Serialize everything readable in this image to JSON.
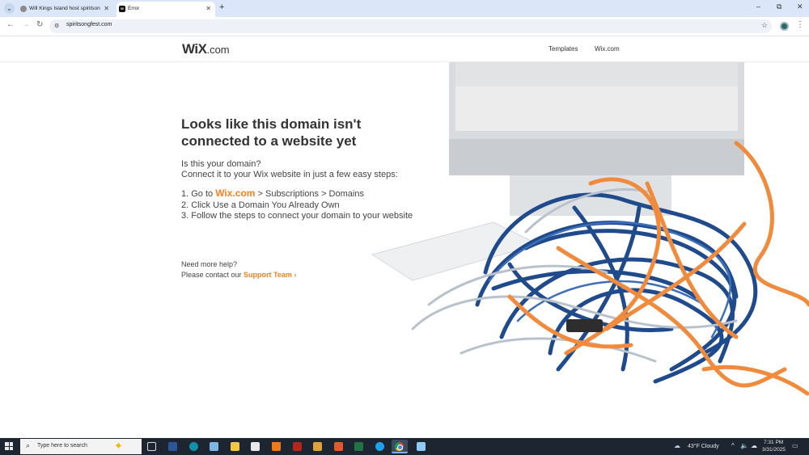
{
  "browser": {
    "tabs": [
      {
        "title": "Will Kings Island host spiritsong",
        "active": false
      },
      {
        "title": "Error",
        "active": true
      }
    ],
    "new_tab": "+",
    "url": "spiritsongfest.com",
    "window_controls": {
      "minimize": "–",
      "restore": "⧉",
      "close": "✕"
    }
  },
  "site": {
    "logo": "WiX",
    "logo_suffix": ".com",
    "nav": [
      {
        "label": "Templates"
      },
      {
        "label": "Wix.com"
      }
    ],
    "headline_line1": "Looks like this domain isn't",
    "headline_line2": "connected to a website yet",
    "question": "Is this your domain?",
    "intro": "Connect it to your Wix website in just a few easy steps:",
    "step1_prefix": "1. Go to ",
    "step1_link": "Wix.com",
    "step1_suffix": " > Subscriptions > Domains",
    "step2": "2. Click Use a Domain You Already Own",
    "step3": "3. Follow the steps to connect your domain to your website",
    "help_title": "Need more help?",
    "help_prefix": "Please contact our ",
    "support_link": "Support Team",
    "support_arrow": " ›",
    "accent_color": "#f58220"
  },
  "taskbar": {
    "search_placeholder": "Type here to search",
    "apps": [
      "task-view",
      "word",
      "edge",
      "photos",
      "file-explorer",
      "store",
      "vlc",
      "media-app",
      "media-player",
      "pdf-app",
      "excel",
      "internet-explorer",
      "chrome",
      "mail"
    ],
    "weather": "43°F  Cloudy",
    "time": "7:31 PM",
    "date": "3/31/2025"
  }
}
